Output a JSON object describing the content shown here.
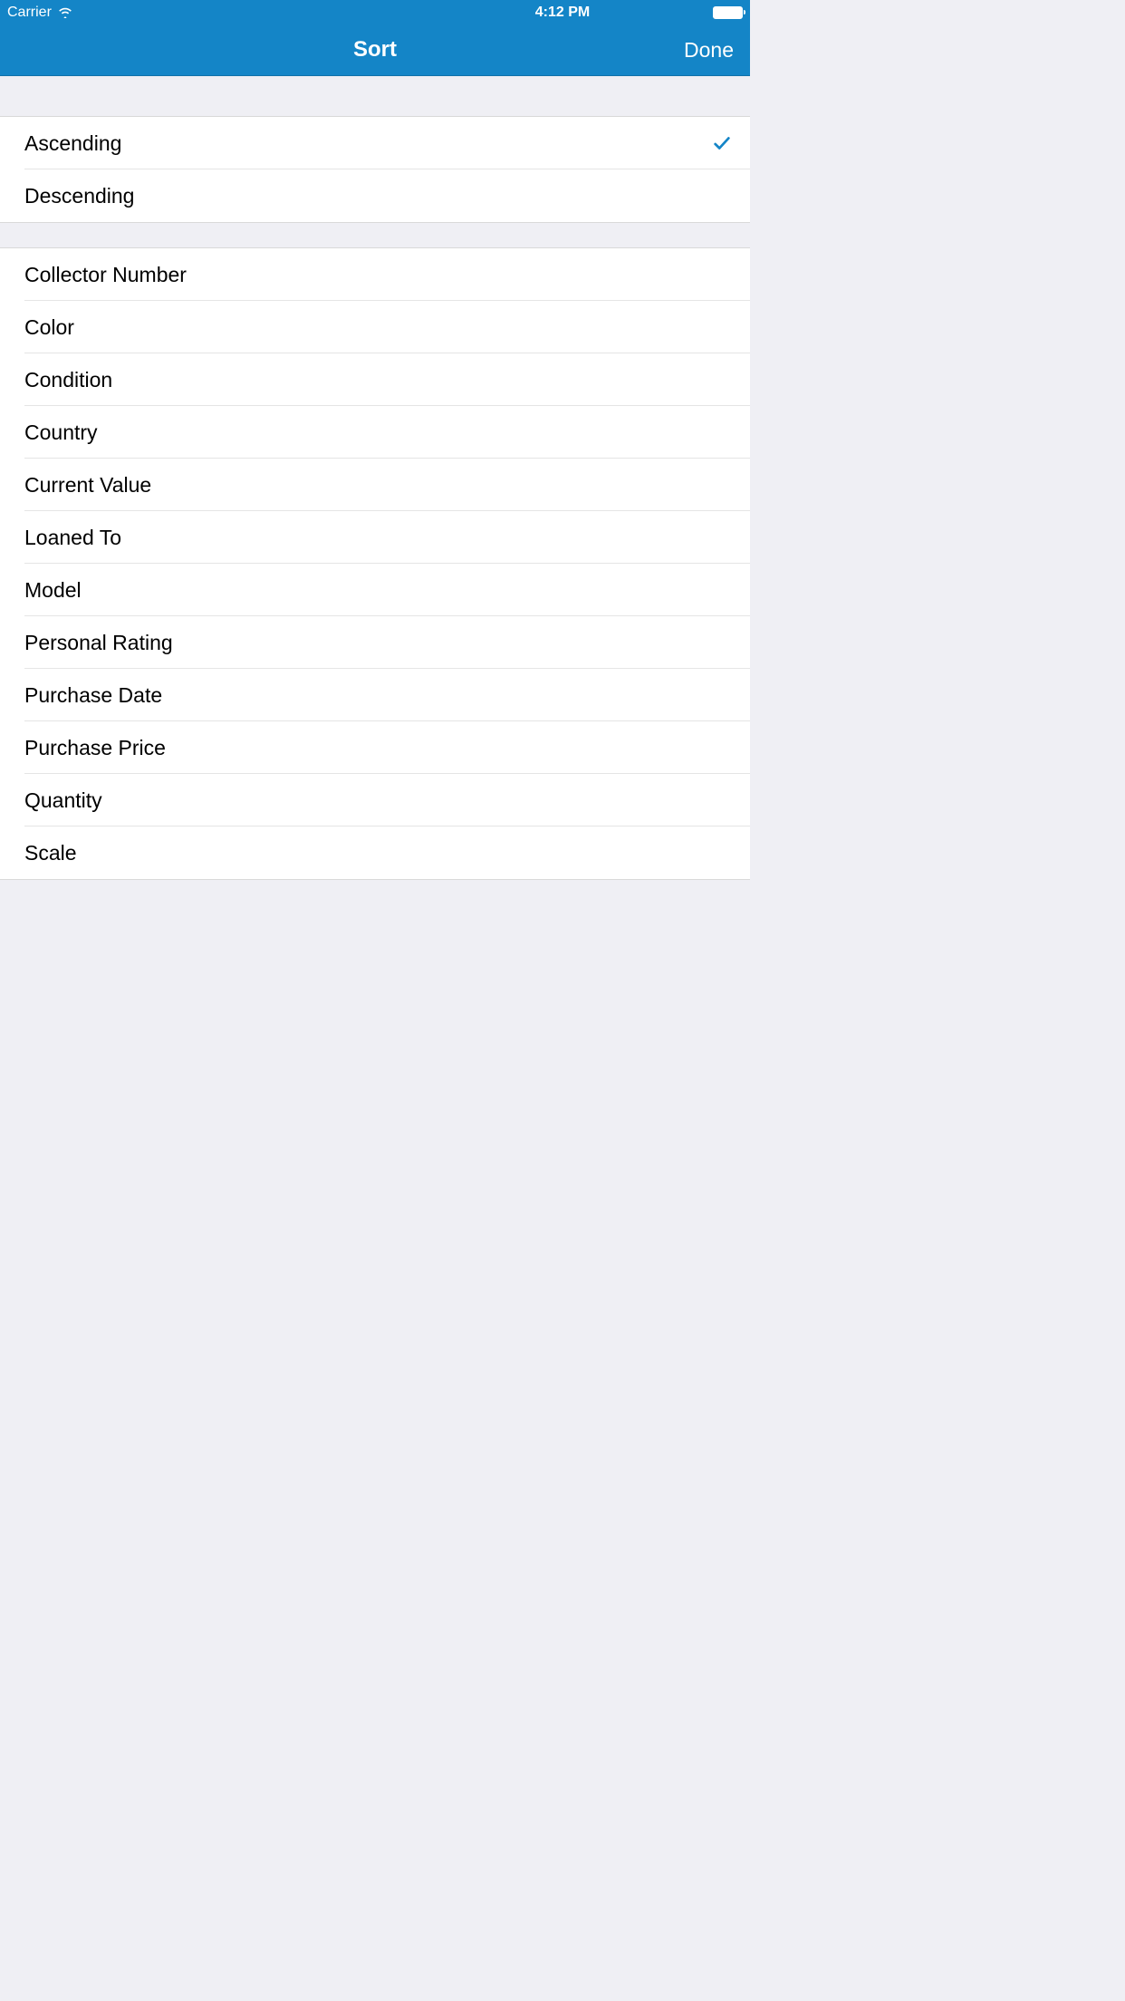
{
  "status_bar": {
    "carrier": "Carrier",
    "time": "4:12 PM"
  },
  "nav": {
    "title": "Sort",
    "done_label": "Done"
  },
  "sort_direction": {
    "items": [
      {
        "label": "Ascending",
        "selected": true
      },
      {
        "label": "Descending",
        "selected": false
      }
    ]
  },
  "sort_fields": {
    "items": [
      {
        "label": "Collector Number"
      },
      {
        "label": "Color"
      },
      {
        "label": "Condition"
      },
      {
        "label": "Country"
      },
      {
        "label": "Current Value"
      },
      {
        "label": "Loaned To"
      },
      {
        "label": "Model"
      },
      {
        "label": "Personal Rating"
      },
      {
        "label": "Purchase Date"
      },
      {
        "label": "Purchase Price"
      },
      {
        "label": "Quantity"
      },
      {
        "label": "Scale"
      }
    ]
  },
  "colors": {
    "accent": "#1485C7"
  }
}
